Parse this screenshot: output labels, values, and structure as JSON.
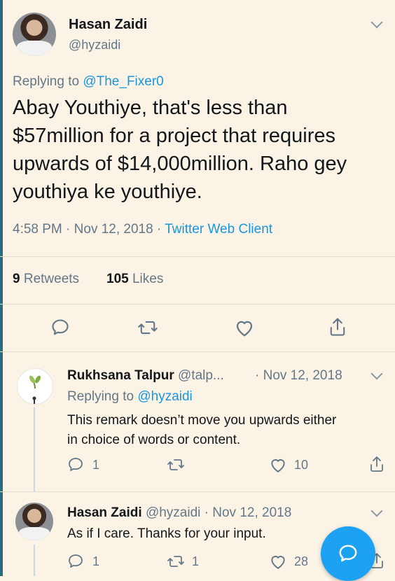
{
  "main_tweet": {
    "author_name": "Hasan Zaidi",
    "handle": "@hyzaidi",
    "replying_prefix": "Replying to",
    "replying_to": "@The_Fixer0",
    "text_lines": [
      "Abay Youthiye, that's less than",
      "$57million for a project that requires",
      "upwards of $14,000million. Raho gey",
      "youthiya ke youthiye."
    ],
    "time": "4:58 PM",
    "date": "Nov 12, 2018",
    "client": "Twitter Web Client",
    "retweets_count": "9",
    "retweets_label": "Retweets",
    "likes_count": "105",
    "likes_label": "Likes"
  },
  "replies": [
    {
      "author_name": "Rukhsana Talpur",
      "handle": "@talp...",
      "date": "Nov 12, 2018",
      "replying_prefix": "Replying to",
      "replying_to": "@hyzaidi",
      "text_lines": [
        "This remark doesn’t move you upwards either",
        "in choice of words or content."
      ],
      "reply_count": "1",
      "retweet_count": "",
      "like_count": "10"
    },
    {
      "author_name": "Hasan Zaidi",
      "handle": "@hyzaidi",
      "date": "Nov 12, 2018",
      "text_lines": [
        "As if I care. Thanks for your input."
      ],
      "reply_count": "1",
      "retweet_count": "1",
      "like_count": "28"
    }
  ],
  "separator": "·",
  "colors": {
    "link": "#1b95e0",
    "muted": "#657786",
    "background": "#faf3e6",
    "fab": "#1da1f2"
  },
  "icons": [
    "reply-icon",
    "retweet-icon",
    "like-icon",
    "share-icon",
    "chevron-down-icon",
    "compose-reply-icon"
  ]
}
